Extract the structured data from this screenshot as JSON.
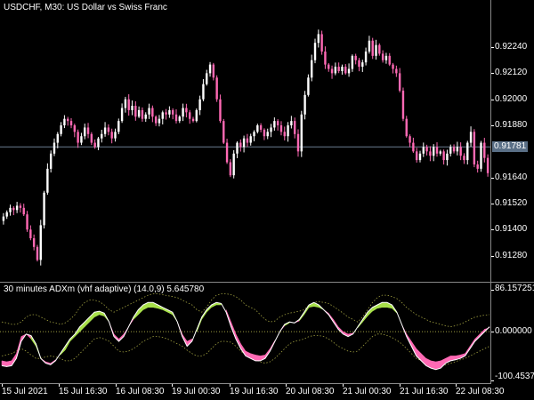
{
  "chart": {
    "symbol_title": "USDCHF, M30:  US Dollar vs Swiss Franc",
    "current_price": "0.91781",
    "price_labels": [
      "0.92240",
      "0.92120",
      "0.92000",
      "0.91880",
      "0.91640",
      "0.91520",
      "0.91400",
      "0.91280"
    ],
    "price_values": [
      0.9224,
      0.9212,
      0.92,
      0.9188,
      0.9164,
      0.9152,
      0.914,
      0.9128
    ],
    "current_price_value": 0.91781,
    "price_range": [
      0.9118,
      0.924
    ],
    "bull_color": "#ffffff",
    "bear_color": "#ff69b4",
    "candles_close": [
      0.9146,
      0.9148,
      0.915,
      0.9149,
      0.9151,
      0.915,
      0.9147,
      0.914,
      0.9136,
      0.9132,
      0.9126,
      0.9142,
      0.9157,
      0.9168,
      0.9175,
      0.918,
      0.9184,
      0.9188,
      0.9191,
      0.919,
      0.9188,
      0.9185,
      0.918,
      0.9183,
      0.9187,
      0.9184,
      0.918,
      0.9178,
      0.9182,
      0.9184,
      0.9187,
      0.9185,
      0.9182,
      0.9185,
      0.919,
      0.9196,
      0.92,
      0.9195,
      0.9197,
      0.9192,
      0.9195,
      0.9191,
      0.9193,
      0.9196,
      0.9192,
      0.9189,
      0.9191,
      0.9194,
      0.9193,
      0.9195,
      0.9193,
      0.919,
      0.9192,
      0.9196,
      0.9194,
      0.9191,
      0.919,
      0.9195,
      0.92,
      0.9207,
      0.9212,
      0.9216,
      0.921,
      0.92,
      0.919,
      0.918,
      0.9171,
      0.9165,
      0.9175,
      0.918,
      0.9178,
      0.9182,
      0.918,
      0.9183,
      0.9185,
      0.9188,
      0.9186,
      0.9183,
      0.9185,
      0.9187,
      0.919,
      0.9188,
      0.9185,
      0.9183,
      0.9188,
      0.919,
      0.9184,
      0.9176,
      0.9193,
      0.9202,
      0.921,
      0.9218,
      0.9226,
      0.923,
      0.9222,
      0.9216,
      0.9214,
      0.9212,
      0.9215,
      0.9213,
      0.9215,
      0.9212,
      0.9214,
      0.922,
      0.9218,
      0.9215,
      0.9217,
      0.9222,
      0.9227,
      0.922,
      0.9225,
      0.9221,
      0.9218,
      0.922,
      0.9216,
      0.9214,
      0.9212,
      0.9204,
      0.9191,
      0.9183,
      0.918,
      0.9176,
      0.9172,
      0.9175,
      0.9178,
      0.9176,
      0.9174,
      0.9178,
      0.9175,
      0.9176,
      0.9172,
      0.9175,
      0.9178,
      0.9176,
      0.9178,
      0.9174,
      0.9172,
      0.918,
      0.9185,
      0.917,
      0.9168,
      0.918,
      0.9173,
      0.9166
    ]
  },
  "indicator": {
    "label": "30 minutes ADXm (vhf adaptive) (14.0,9) 5.645780",
    "axis_labels": [
      "86.157251",
      "0.000000",
      "-100.45376"
    ],
    "axis_values": [
      86.157251,
      0.0,
      -100.45376
    ],
    "range": [
      -100.45376,
      86.157251
    ],
    "up_color": "#a8e04a",
    "down_color": "#ff69b4",
    "line_color": "#ffffff",
    "level_color": "#a0a040",
    "main_line": [
      -70,
      -72,
      -70,
      -55,
      -20,
      -5,
      -8,
      -25,
      -55,
      -65,
      -68,
      -60,
      -45,
      -30,
      -15,
      -5,
      10,
      20,
      30,
      40,
      42,
      38,
      20,
      -10,
      -20,
      -10,
      10,
      30,
      45,
      55,
      60,
      60,
      55,
      50,
      45,
      40,
      20,
      -10,
      -30,
      -20,
      5,
      30,
      45,
      55,
      60,
      58,
      40,
      10,
      -15,
      -35,
      -50,
      -55,
      -60,
      -60,
      -55,
      -40,
      -20,
      0,
      15,
      20,
      18,
      25,
      40,
      55,
      60,
      55,
      45,
      35,
      20,
      5,
      -5,
      -10,
      -5,
      10,
      25,
      40,
      50,
      55,
      60,
      60,
      55,
      40,
      15,
      -10,
      -30,
      -50,
      -60,
      -70,
      -75,
      -78,
      -75,
      -65,
      -60,
      -58,
      -55,
      -50,
      -35,
      -20,
      -10,
      0,
      10
    ],
    "fill_line": [
      -60,
      -62,
      -60,
      -45,
      -10,
      -5,
      -15,
      -30,
      -55,
      -62,
      -65,
      -58,
      -48,
      -38,
      -20,
      -10,
      0,
      10,
      20,
      30,
      35,
      32,
      20,
      -5,
      -15,
      -5,
      10,
      25,
      35,
      45,
      50,
      50,
      48,
      45,
      40,
      35,
      20,
      -5,
      -20,
      -15,
      0,
      25,
      40,
      50,
      55,
      55,
      45,
      20,
      -5,
      -25,
      -40,
      -45,
      -48,
      -50,
      -48,
      -35,
      -18,
      0,
      12,
      18,
      18,
      22,
      35,
      50,
      52,
      50,
      45,
      38,
      25,
      10,
      0,
      -5,
      -3,
      8,
      20,
      32,
      42,
      48,
      50,
      50,
      48,
      38,
      15,
      -5,
      -20,
      -35,
      -45,
      -55,
      -60,
      -62,
      -60,
      -55,
      -50,
      -50,
      -48,
      -45,
      -30,
      -15,
      -5,
      5,
      8
    ],
    "upper_level": [
      20,
      18,
      15,
      15,
      20,
      30,
      35,
      35,
      30,
      25,
      20,
      18,
      15,
      18,
      25,
      35,
      50,
      60,
      65,
      65,
      62,
      55,
      45,
      40,
      45,
      50,
      55,
      60,
      65,
      70,
      75,
      78,
      78,
      76,
      74,
      72,
      70,
      65,
      60,
      55,
      45,
      40,
      50,
      65,
      75,
      78,
      78,
      76,
      72,
      65,
      55,
      50,
      45,
      35,
      25,
      20,
      22,
      30,
      35,
      38,
      40,
      42,
      45,
      55,
      60,
      62,
      60,
      58,
      52,
      45,
      38,
      30,
      25,
      20,
      30,
      45,
      60,
      70,
      75,
      75,
      72,
      68,
      60,
      50,
      42,
      35,
      30,
      25,
      20,
      18,
      15,
      12,
      10,
      12,
      15,
      20,
      25,
      30,
      32,
      34,
      35
    ],
    "lower_level": [
      -50,
      -48,
      -45,
      -40,
      -35,
      -40,
      -48,
      -55,
      -55,
      -52,
      -50,
      -52,
      -55,
      -60,
      -60,
      -55,
      -45,
      -35,
      -25,
      -15,
      -12,
      -15,
      -20,
      -30,
      -40,
      -42,
      -40,
      -35,
      -28,
      -20,
      -15,
      -10,
      -10,
      -12,
      -15,
      -20,
      -25,
      -30,
      -38,
      -45,
      -50,
      -50,
      -45,
      -35,
      -25,
      -20,
      -20,
      -22,
      -30,
      -40,
      -48,
      -55,
      -58,
      -62,
      -65,
      -62,
      -55,
      -45,
      -35,
      -25,
      -20,
      -18,
      -15,
      -10,
      -8,
      -8,
      -10,
      -15,
      -22,
      -30,
      -35,
      -40,
      -42,
      -40,
      -30,
      -20,
      -10,
      -5,
      -5,
      -8,
      -12,
      -18,
      -25,
      -35,
      -45,
      -55,
      -60,
      -65,
      -70,
      -72,
      -70,
      -68,
      -65,
      -62,
      -58,
      -55,
      -50,
      -45,
      -40,
      -35,
      -30
    ]
  },
  "time_axis": {
    "labels": [
      "15 Jul 2021",
      "15 Jul 16:30",
      "16 Jul 08:30",
      "19 Jul 00:30",
      "19 Jul 16:30",
      "20 Jul 08:30",
      "21 Jul 00:30",
      "21 Jul 16:30",
      "22 Jul 08:30"
    ]
  }
}
